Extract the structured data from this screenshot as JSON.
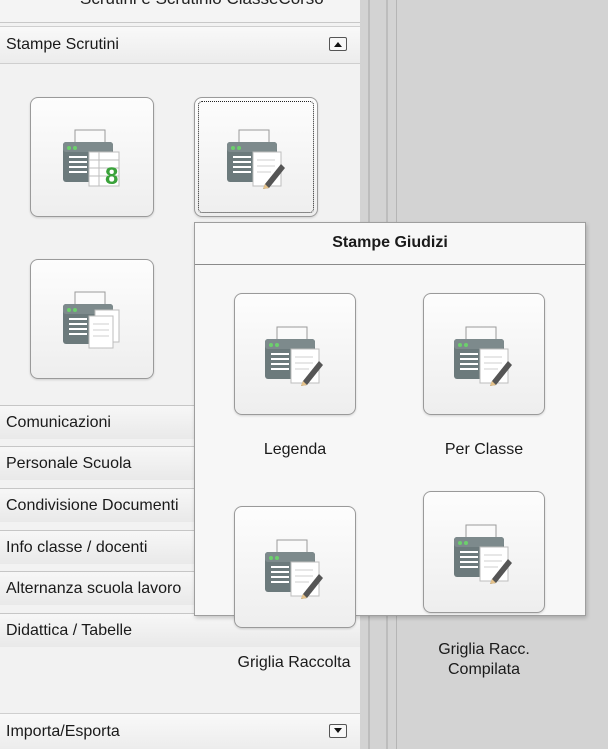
{
  "top_strip_text": "Scrutini e Scrutinio ClasseCorso",
  "sections": {
    "stampe_scrutini": {
      "label": "Stampe Scrutini",
      "toggle_icon": "collapse-arrow-up"
    },
    "importa_esporta": {
      "label": "Importa/Esporta",
      "toggle_icon": "expand-arrow-down"
    }
  },
  "nav_items": [
    {
      "label": "Comunicazioni"
    },
    {
      "label": "Personale Scuola"
    },
    {
      "label": "Condivisione Documenti"
    },
    {
      "label": "Info classe / docenti"
    },
    {
      "label": "Alternanza scuola lavoro"
    },
    {
      "label": "Didattica / Tabelle"
    }
  ],
  "sidebar_tiles": [
    {
      "icon": "printer-grid-8-icon"
    },
    {
      "icon": "printer-document-pencil-icon"
    },
    {
      "icon": "printer-documents-icon"
    }
  ],
  "popup": {
    "title": "Stampe Giudizi",
    "items": [
      {
        "label": "Legenda",
        "icon": "printer-document-pencil-icon"
      },
      {
        "label": "Per Classe",
        "icon": "printer-document-pencil-icon"
      },
      {
        "label": "Griglia Raccolta",
        "icon": "printer-document-pencil-icon"
      },
      {
        "label_line1": "Griglia Racc.",
        "label_line2": "Compilata",
        "icon": "printer-document-pencil-icon"
      }
    ]
  },
  "colors": {
    "background": "#d3d3d3",
    "panel": "#f2f2f2",
    "accent_green": "#3aa23a"
  }
}
